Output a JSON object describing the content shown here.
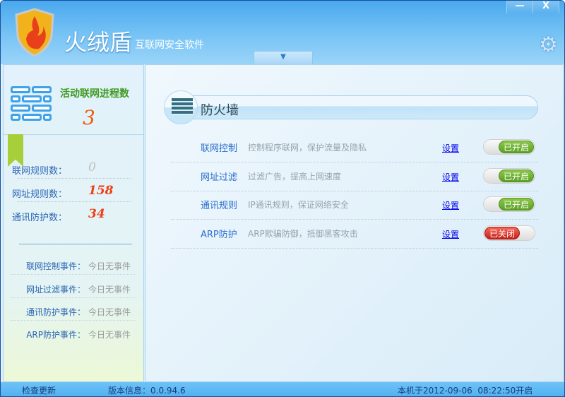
{
  "window": {
    "title": "火绒盾",
    "subtitle": "互联网安全软件",
    "minimize": "—",
    "close": "X"
  },
  "left": {
    "process_title": "活动联网进程数",
    "process_count": "3",
    "stats": [
      {
        "label": "联网规则数：",
        "value": "0"
      },
      {
        "label": "网址规则数：",
        "value": "158"
      },
      {
        "label": "通讯防护数：",
        "value": "34"
      }
    ],
    "events": [
      {
        "label": "联网控制事件：",
        "value": "今日无事件"
      },
      {
        "label": "网址过滤事件：",
        "value": "今日无事件"
      },
      {
        "label": "通讯防护事件：",
        "value": "今日无事件"
      },
      {
        "label": "ARP防护事件：",
        "value": "今日无事件"
      }
    ]
  },
  "main": {
    "section_title": "防火墙",
    "rows": [
      {
        "name": "联网控制",
        "desc": "控制程序联网，保护流量及隐私",
        "settings": "设置",
        "state": "已开启"
      },
      {
        "name": "网址过滤",
        "desc": "过滤广告，提高上网速度",
        "settings": "设置",
        "state": "已开启"
      },
      {
        "name": "通讯规则",
        "desc": "IP通讯规则，保证网络安全",
        "settings": "设置",
        "state": "已开启"
      },
      {
        "name": "ARP防护",
        "desc": "ARP欺骗防御，抵御黑客攻击",
        "settings": "设置",
        "state": "已关闭"
      }
    ]
  },
  "status": {
    "check_update": "检查更新",
    "version": "版本信息：0.0.94.6",
    "boot_time": "本机于2012-09-06  08:22:50开启"
  },
  "colors": {
    "on": "#6cb22f",
    "off": "#d8322a",
    "accent": "#4aa8ee"
  }
}
